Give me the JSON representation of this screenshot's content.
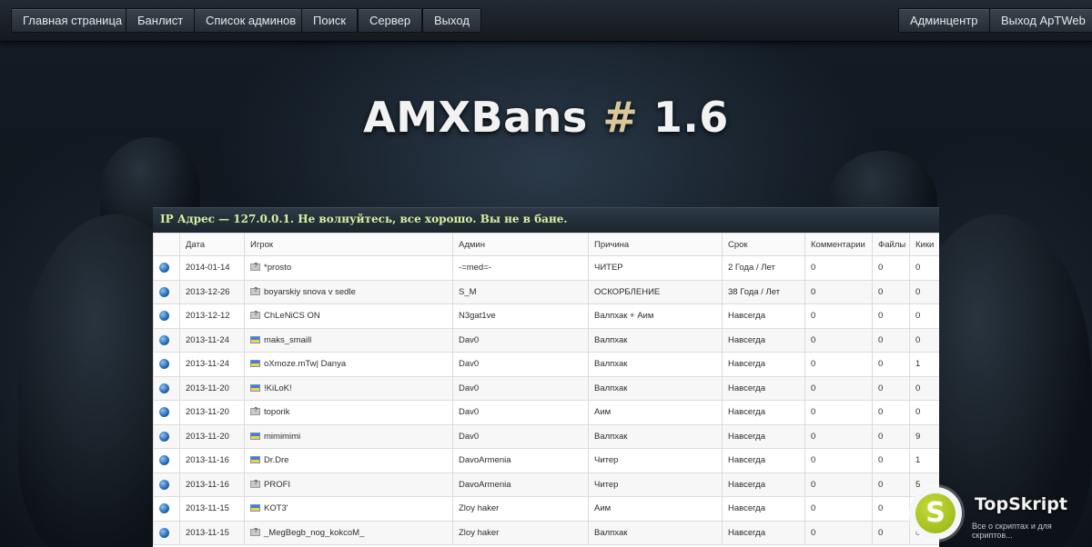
{
  "nav": {
    "left": [
      "Главная страница",
      "Банлист",
      "Список админов",
      "Поиск",
      "Сервер",
      "Выход"
    ],
    "right": [
      "Админцентр",
      "Выход ApTWeb"
    ]
  },
  "logo": {
    "main": "AMXBans",
    "hash": "#",
    "version": "1.6"
  },
  "banner": "IP Адрес — 127.0.0.1. Не волнуйтесь, все хорошо. Вы не в бане.",
  "table": {
    "headers": [
      "",
      "Дата",
      "Игрок",
      "Админ",
      "Причина",
      "Срок",
      "Комментарии",
      "Файлы",
      "Кики"
    ],
    "rows": [
      {
        "date": "2014-01-14",
        "flag": "unknown",
        "player": "*prosto",
        "admin": "-=med=-",
        "reason": "ЧИТЕР",
        "term": "2 Года / Лет",
        "comments": "0",
        "files": "0",
        "kicks": "0"
      },
      {
        "date": "2013-12-26",
        "flag": "unknown",
        "player": "boyarskiy snova v sedle",
        "admin": "S_M",
        "reason": "ОСКОРБЛЕНИЕ",
        "term": "38 Года / Лет",
        "comments": "0",
        "files": "0",
        "kicks": "0"
      },
      {
        "date": "2013-12-12",
        "flag": "unknown",
        "player": "ChLeNiCS ON",
        "admin": "N3gat1ve",
        "reason": "Валпхак + Аим",
        "term": "Навсегда",
        "comments": "0",
        "files": "0",
        "kicks": "0"
      },
      {
        "date": "2013-11-24",
        "flag": "ua",
        "player": "maks_smaill",
        "admin": "Dav0",
        "reason": "Валпхак",
        "term": "Навсегда",
        "comments": "0",
        "files": "0",
        "kicks": "0"
      },
      {
        "date": "2013-11-24",
        "flag": "ua",
        "player": "oXmoze.mTw| Danya",
        "admin": "Dav0",
        "reason": "Валпхак",
        "term": "Навсегда",
        "comments": "0",
        "files": "0",
        "kicks": "1"
      },
      {
        "date": "2013-11-20",
        "flag": "ua",
        "player": "!KiLoK!",
        "admin": "Dav0",
        "reason": "Валпхак",
        "term": "Навсегда",
        "comments": "0",
        "files": "0",
        "kicks": "0"
      },
      {
        "date": "2013-11-20",
        "flag": "unknown",
        "player": "toporik",
        "admin": "Dav0",
        "reason": "Аим",
        "term": "Навсегда",
        "comments": "0",
        "files": "0",
        "kicks": "0"
      },
      {
        "date": "2013-11-20",
        "flag": "ua",
        "player": "mimimimi",
        "admin": "Dav0",
        "reason": "Валпхак",
        "term": "Навсегда",
        "comments": "0",
        "files": "0",
        "kicks": "9"
      },
      {
        "date": "2013-11-16",
        "flag": "ua",
        "player": "Dr.Dre",
        "admin": "DavoArmenia",
        "reason": "Читер",
        "term": "Навсегда",
        "comments": "0",
        "files": "0",
        "kicks": "1"
      },
      {
        "date": "2013-11-16",
        "flag": "unknown",
        "player": "PROFI",
        "admin": "DavoArmenia",
        "reason": "Читер",
        "term": "Навсегда",
        "comments": "0",
        "files": "0",
        "kicks": "5"
      },
      {
        "date": "2013-11-15",
        "flag": "ua",
        "player": "KOT3'",
        "admin": "Zloy haker",
        "reason": "Аим",
        "term": "Навсегда",
        "comments": "0",
        "files": "0",
        "kicks": "0"
      },
      {
        "date": "2013-11-15",
        "flag": "unknown",
        "player": "_MegBegb_nog_kokcoM_",
        "admin": "Zloy haker",
        "reason": "Валпхак",
        "term": "Навсегда",
        "comments": "0",
        "files": "0",
        "kicks": "0"
      }
    ]
  },
  "watermark": {
    "letter": "S",
    "title": "TopSkript",
    "subtitle": "Все о скриптах и для скриптов..."
  }
}
